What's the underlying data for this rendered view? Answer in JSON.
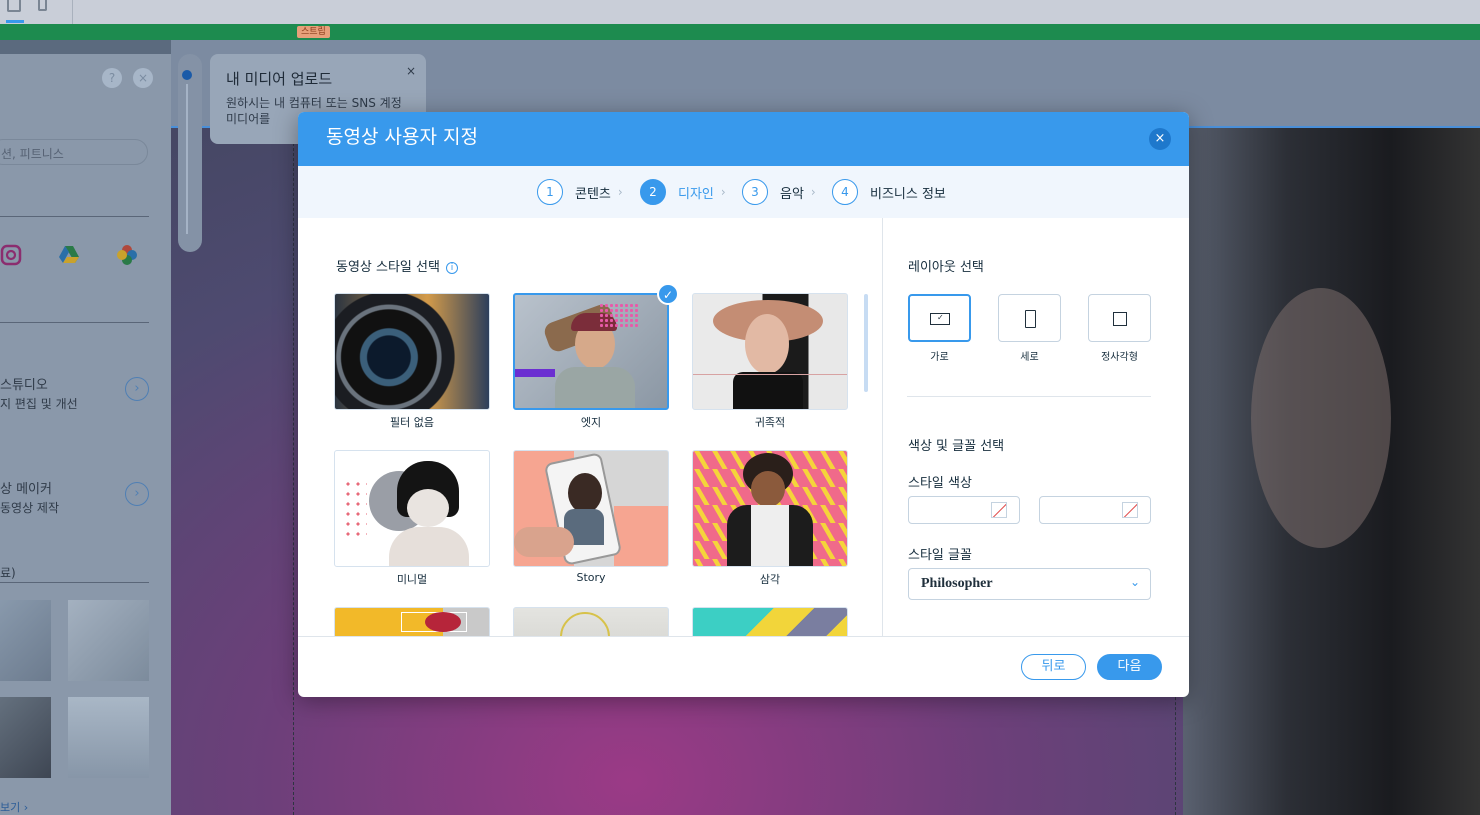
{
  "editor": {
    "strip_tag": "스트립",
    "left_panel": {
      "search_placeholder": "션, 피트니스",
      "studio_title": "스튜디오",
      "studio_sub": "지 편집 및 개선",
      "maker_title": "상 메이커",
      "maker_sub": "동영상 제작",
      "section_label": "료)",
      "more_link": "보기 ›"
    },
    "tooltip": {
      "title": "내 미디어 업로드",
      "body": "원하시는 내 컴퓨터 또는 SNS 계정 미디어를 ",
      "close": "×"
    }
  },
  "modal": {
    "title": "동영상 사용자 지정",
    "close": "×",
    "steps": [
      {
        "num": "1",
        "label": "콘텐츠"
      },
      {
        "num": "2",
        "label": "디자인"
      },
      {
        "num": "3",
        "label": "음악"
      },
      {
        "num": "4",
        "label": "비즈니스 정보"
      }
    ],
    "active_step": 2,
    "style_section": {
      "title": "동영상 스타일 선택",
      "info": "i",
      "tiles": [
        {
          "caption": "필터 없음",
          "selected": false
        },
        {
          "caption": "엣지",
          "selected": true
        },
        {
          "caption": "귀족적",
          "selected": false
        },
        {
          "caption": "미니멀",
          "selected": false
        },
        {
          "caption": "Story",
          "selected": false
        },
        {
          "caption": "삼각",
          "selected": false
        }
      ]
    },
    "layout_section": {
      "title": "레이아웃 선택",
      "options": [
        {
          "caption": "가로",
          "selected": true
        },
        {
          "caption": "세로",
          "selected": false
        },
        {
          "caption": "정사각형",
          "selected": false
        }
      ]
    },
    "color_font_section": {
      "title": "색상 및 글꼴 선택",
      "style_color_label": "스타일 색상",
      "style_font_label": "스타일 글꼴",
      "font_value": "Philosopher"
    },
    "buttons": {
      "back": "뒤로",
      "next": "다음"
    },
    "colors": {
      "accent": "#3899ec",
      "header": "#3899ec",
      "steps_bg": "#f0f6fd"
    }
  }
}
